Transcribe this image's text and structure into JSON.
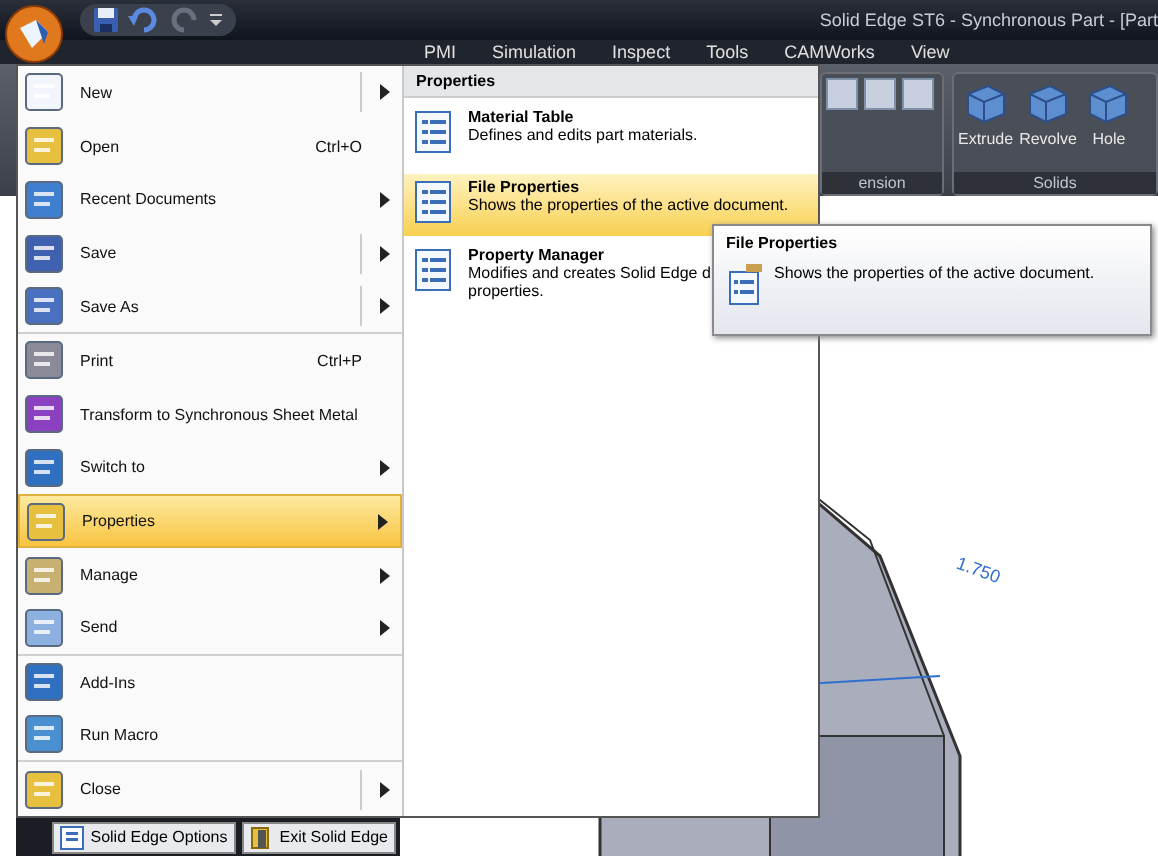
{
  "window": {
    "title": "Solid Edge ST6 - Synchronous Part - [Part"
  },
  "ribbon": {
    "tabs": [
      {
        "label": "PMI",
        "selected": false
      },
      {
        "label": "Simulation",
        "selected": false
      },
      {
        "label": "Inspect",
        "selected": false
      },
      {
        "label": "Tools",
        "selected": false
      },
      {
        "label": "CAMWorks",
        "selected": false
      },
      {
        "label": "View",
        "selected": false
      }
    ],
    "groups": [
      {
        "label": "ension"
      },
      {
        "label": "Solids",
        "buttons": [
          "Extrude",
          "Revolve",
          "Hole"
        ]
      }
    ]
  },
  "canvas": {
    "dimension": "1.750"
  },
  "application_menu": {
    "items": [
      {
        "label": "New",
        "submenu": true,
        "split": true,
        "selected": false,
        "divider": false
      },
      {
        "label": "Open",
        "shortcut": "Ctrl+O",
        "submenu": false,
        "split": false,
        "selected": false,
        "divider": false
      },
      {
        "label": "Recent Documents",
        "submenu": true,
        "split": false,
        "selected": false,
        "divider": false
      },
      {
        "label": "Save",
        "submenu": true,
        "split": true,
        "selected": false,
        "divider": false
      },
      {
        "label": "Save As",
        "submenu": true,
        "split": true,
        "selected": false,
        "divider": true
      },
      {
        "label": "Print",
        "shortcut": "Ctrl+P",
        "submenu": false,
        "split": false,
        "selected": false,
        "divider": false
      },
      {
        "label": "Transform to Synchronous Sheet Metal",
        "submenu": false,
        "split": false,
        "selected": false,
        "divider": false
      },
      {
        "label": "Switch to",
        "submenu": true,
        "split": false,
        "selected": false,
        "divider": false
      },
      {
        "label": "Properties",
        "submenu": true,
        "split": false,
        "selected": true,
        "divider": false
      },
      {
        "label": "Manage",
        "submenu": true,
        "split": false,
        "selected": false,
        "divider": false
      },
      {
        "label": "Send",
        "submenu": true,
        "split": false,
        "selected": false,
        "divider": true
      },
      {
        "label": "Add-Ins",
        "submenu": false,
        "split": false,
        "selected": false,
        "divider": false
      },
      {
        "label": "Run Macro",
        "submenu": false,
        "split": false,
        "selected": false,
        "divider": true
      },
      {
        "label": "Close",
        "submenu": true,
        "split": true,
        "selected": false,
        "divider": false
      }
    ],
    "footer_buttons": [
      "Solid Edge Options",
      "Exit Solid Edge"
    ]
  },
  "submenu": {
    "title": "Properties",
    "items": [
      {
        "title": "Material Table",
        "description": "Defines and edits part materials.",
        "selected": false
      },
      {
        "title": "File Properties",
        "description": "Shows the properties of the active document.",
        "selected": true
      },
      {
        "title": "Property Manager",
        "description": "Modifies and creates Solid Edge d",
        "description_line_2": "properties.",
        "selected": false
      }
    ]
  },
  "tooltip": {
    "title": "File Properties",
    "text": "Shows the properties of the active document."
  }
}
